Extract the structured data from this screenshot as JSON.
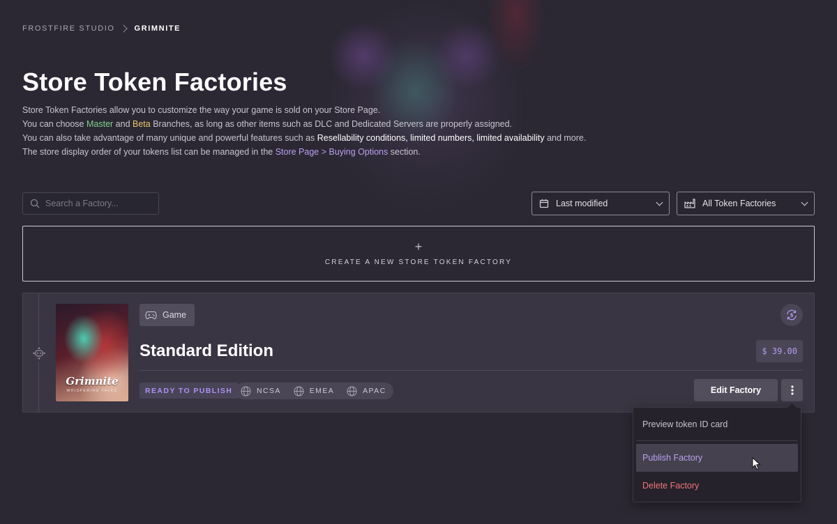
{
  "breadcrumb": {
    "parent": "FROSTFIRE STUDIO",
    "current": "GRIMNITE"
  },
  "page": {
    "title": "Store Token Factories",
    "desc": {
      "line1": "Store Token Factories allow you to customize the way your game is sold on your Store Page.",
      "line2_pre": "You can choose ",
      "line2_master": "Master",
      "line2_and": " and ",
      "line2_beta": "Beta",
      "line2_post": " Branches, as long as other items such as DLC and Dedicated Servers are properly assigned.",
      "line3_pre": "You can also take advantage of many unique and powerful features such as ",
      "line3_highlight": "Resellability conditions, limited numbers, limited availability",
      "line3_post": " and more.",
      "line4_pre": "The store display order of your tokens list can be managed in the ",
      "line4_link": "Store Page > Buying Options",
      "line4_post": " section."
    }
  },
  "toolbar": {
    "search_placeholder": "Search a Factory...",
    "sort_value": "Last modified",
    "filter_value": "All Token Factories"
  },
  "create": {
    "label": "CREATE A NEW STORE TOKEN FACTORY"
  },
  "factory": {
    "type": "Game",
    "name": "Standard Edition",
    "price": "$ 39.00",
    "status": "READY TO PUBLISH",
    "regions": [
      "NCSA",
      "EMEA",
      "APAC"
    ],
    "cover_title": "Grimnite",
    "cover_subtitle": "WHISPERING TALES",
    "edit_label": "Edit Factory"
  },
  "menu": {
    "preview": "Preview token ID card",
    "publish": "Publish Factory",
    "delete": "Delete Factory"
  },
  "colors": {
    "background": "#2b2833",
    "card": "#393542",
    "accent_purple": "#b9a2ee",
    "danger": "#f0757a",
    "master_green": "#7fd28e",
    "beta_yellow": "#e8c86a"
  }
}
